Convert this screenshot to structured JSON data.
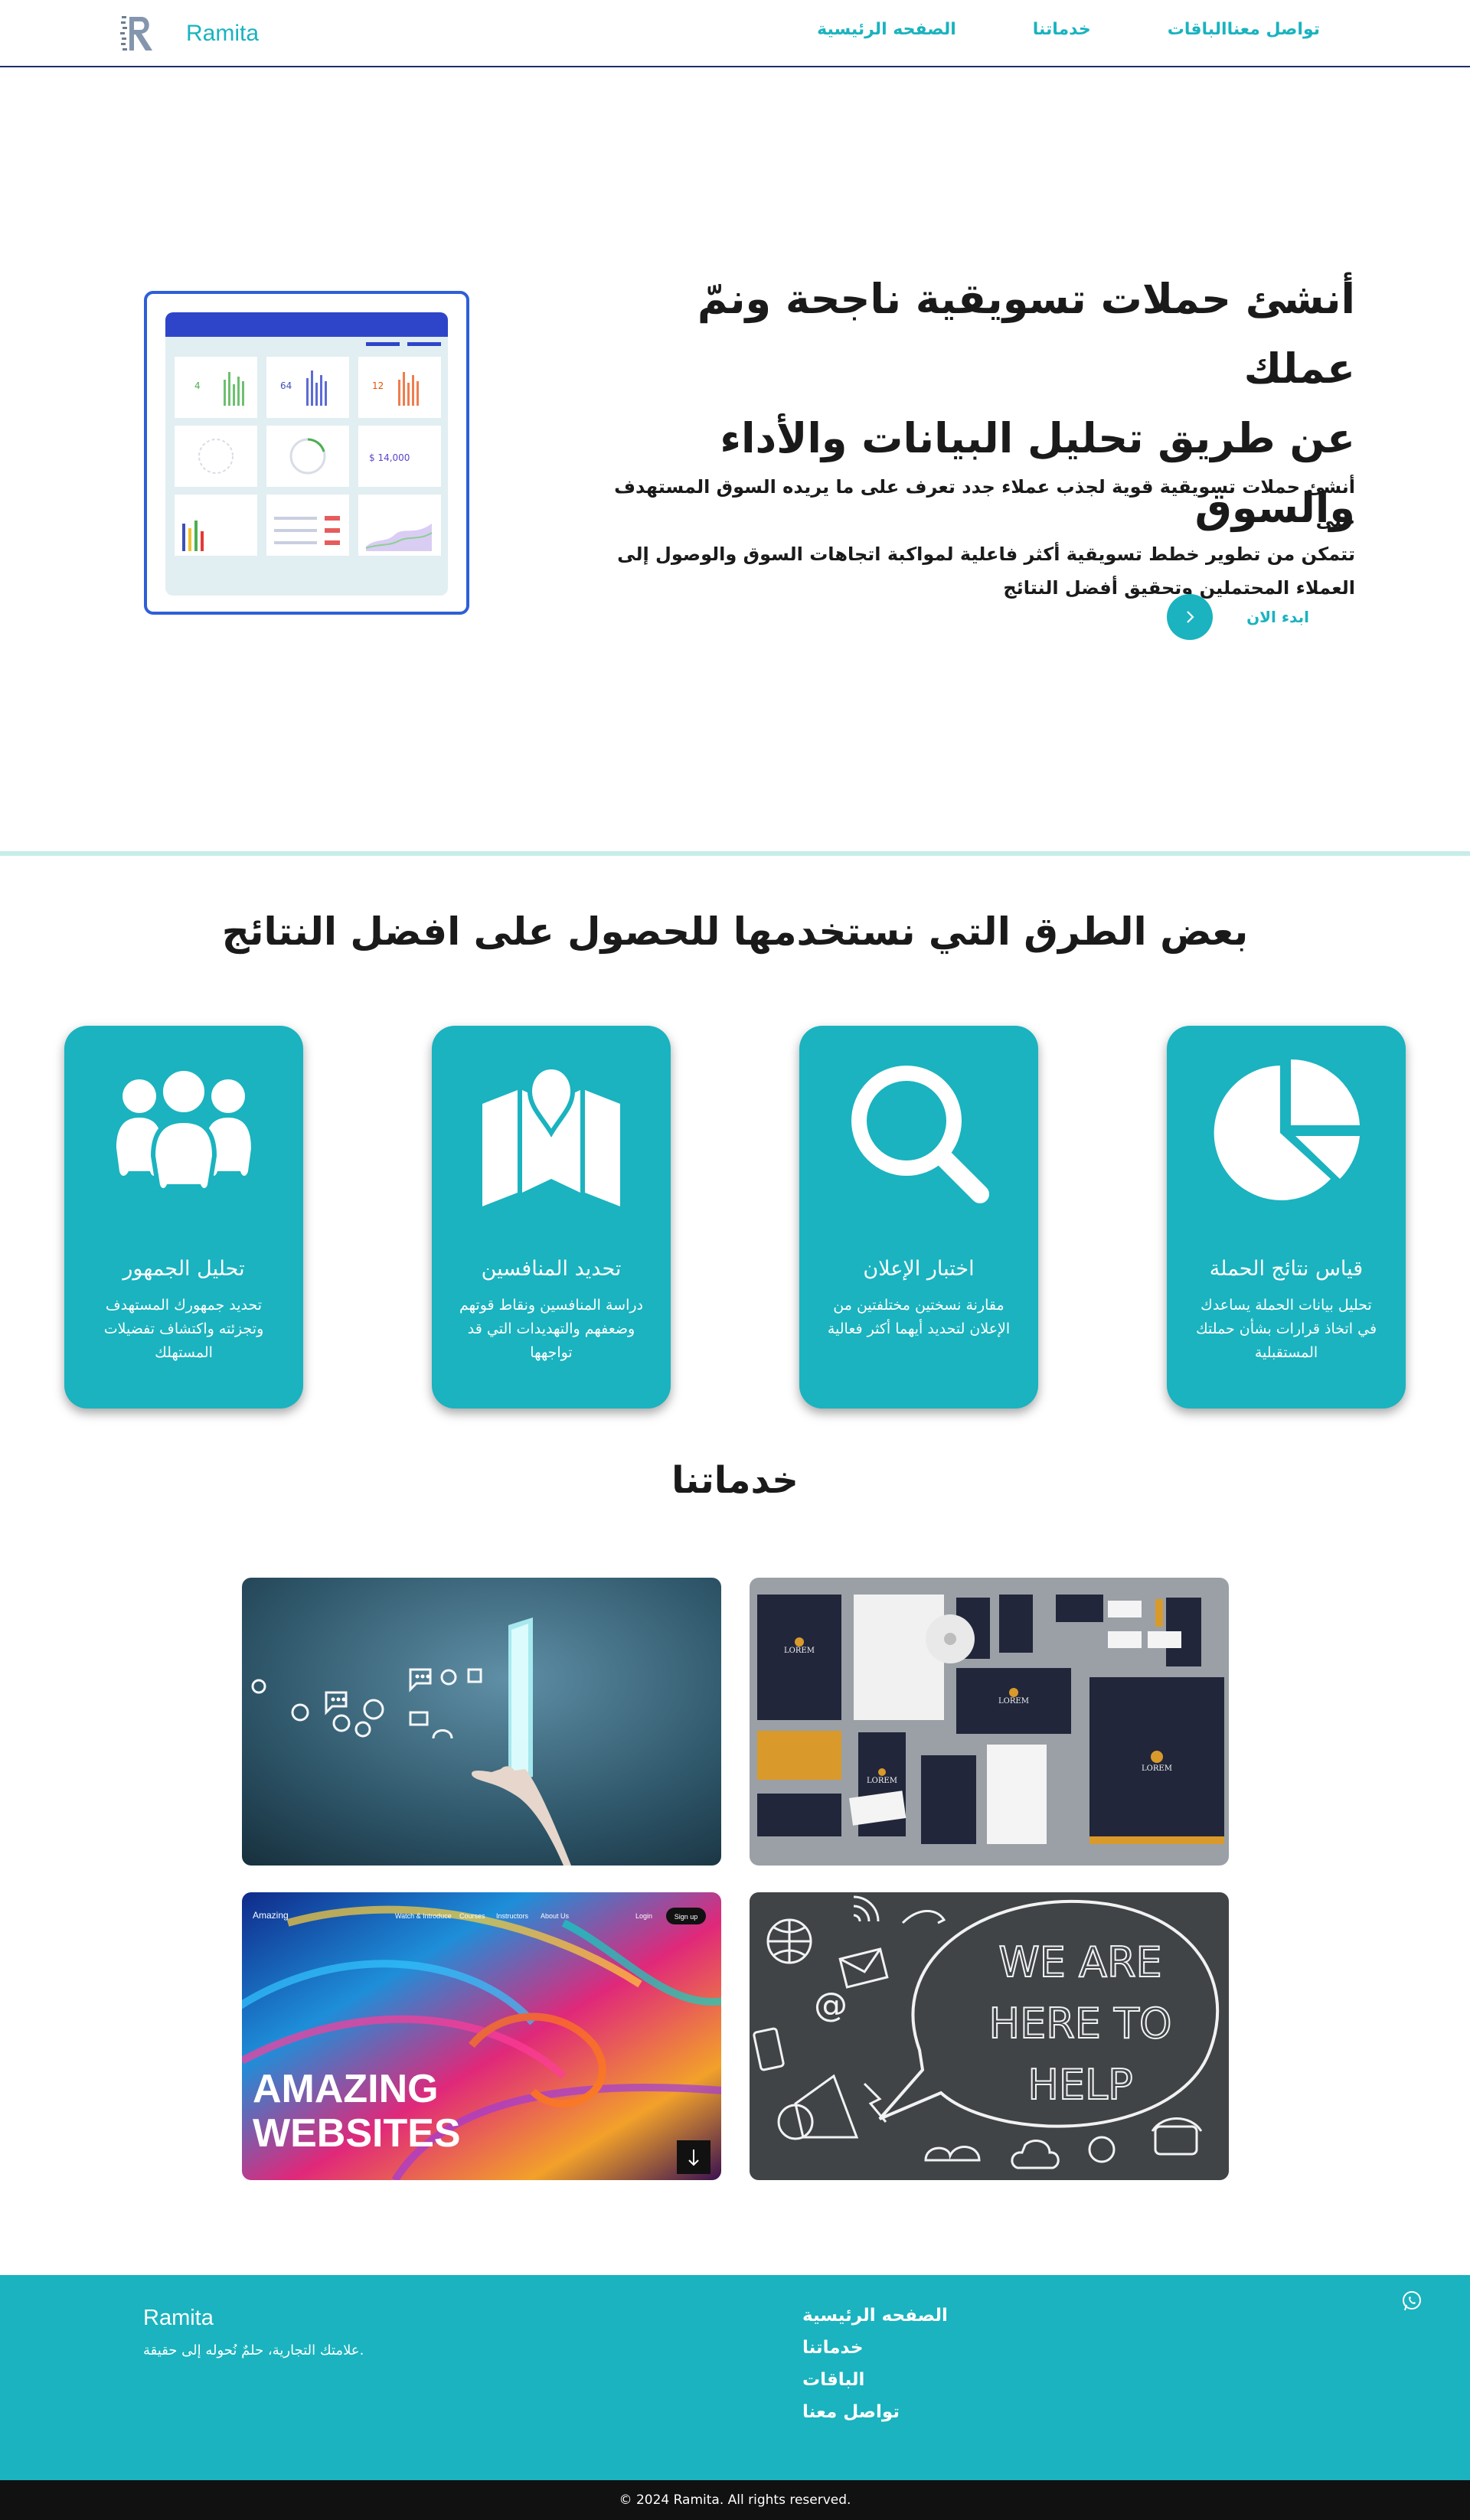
{
  "brand": {
    "name": "Ramita",
    "logo_letter": "R"
  },
  "nav": {
    "items": [
      "تواصل معنا",
      "الباقات",
      "خدماتنا",
      "الصفحه الرئيسية"
    ]
  },
  "hero": {
    "title_lines": [
      "أنشئ حملات تسويقية ناجحة ونمّ عملك",
      "عن طريق تحليل البيانات والأداء",
      "والسوق"
    ],
    "description_lines": [
      "أنشئ حملات تسويقية قوية لجذب عملاء جدد تعرف على ما يريده السوق المستهدف حتى",
      "تتمكن من تطوير خطط تسويقية أكثر فاعلية لمواكبة اتجاهات السوق والوصول إلى",
      "العملاء المحتملين وتحقيق أفضل النتائج"
    ],
    "cta_label": "ابدء الان",
    "cta_icon": "chevron-right-icon",
    "dashboard": {
      "stats": [
        "4",
        "64",
        "12"
      ],
      "amount": "$ 14,000"
    }
  },
  "methods": {
    "title": "بعض الطرق التي نستخدمها للحصول على افضل النتائج",
    "cards": [
      {
        "icon": "pie-chart-icon",
        "title": "قياس نتائج الحملة",
        "description": "تحليل بيانات الحملة يساعدك في اتخاذ قرارات بشأن حملتك المستقبلية"
      },
      {
        "icon": "search-icon",
        "title": "اختبار الإعلان",
        "description": "مقارنة نسختين مختلفتين من الإعلان لتحديد أيهما أكثر فعالية"
      },
      {
        "icon": "map-icon",
        "title": "تحديد المنافسين",
        "description": "دراسة المنافسين ونقاط قوتهم وضعفهم والتهديدات التي قد تواجهها"
      },
      {
        "icon": "audience-icon",
        "title": "تحليل الجمهور",
        "description": "تحديد جمهورك المستهدف وتجزئته واكتشاف تفضيلات المستهلك"
      }
    ]
  },
  "services": {
    "title": "خدماتنا",
    "images": [
      {
        "name": "digital-marketing-image"
      },
      {
        "name": "brand-identity-image",
        "mockup_text": "LOREM"
      },
      {
        "name": "web-design-image",
        "headline_lines": [
          "AMAZING",
          "WEBSITES"
        ],
        "mock_nav": [
          "Amazing",
          "Watch & Introduce",
          "Courses",
          "Instructors",
          "About Us",
          "Login",
          "Sign up"
        ]
      },
      {
        "name": "customer-support-image",
        "chalk_lines": [
          "WE ARE",
          "HERE TO",
          "HELP"
        ]
      }
    ]
  },
  "footer": {
    "brand": "Ramita",
    "tagline": "علامتك التجارية، حلمٌ نُحوله إلى حقيقة.",
    "links": [
      "الصفحه الرئيسية",
      "خدماتنا",
      "الباقات",
      "تواصل معنا"
    ],
    "copyright": "© 2024 Ramita. All rights reserved.",
    "whatsapp_icon": "whatsapp-icon"
  },
  "colors": {
    "accent": "#1ab3bf",
    "nav_border": "#1f2f6b",
    "divider": "#c6ede9",
    "dark": "#111111"
  }
}
